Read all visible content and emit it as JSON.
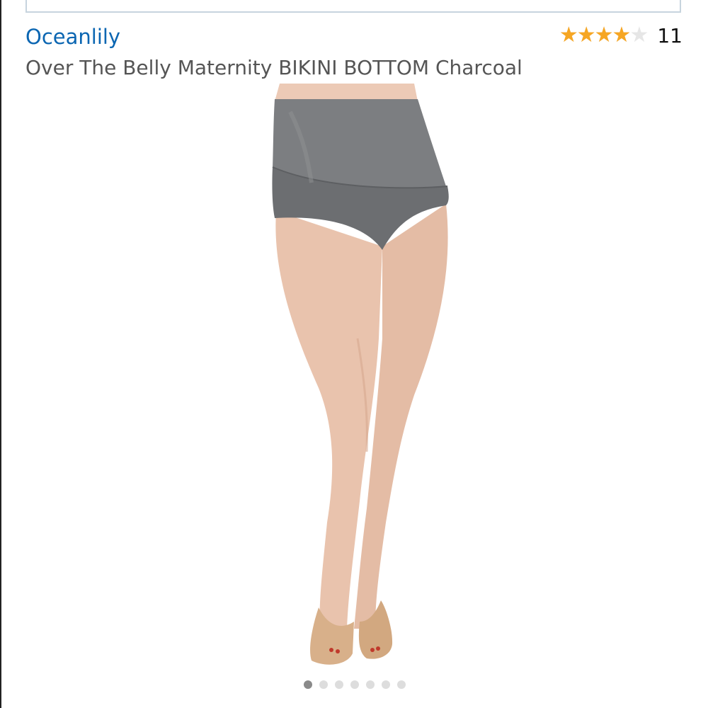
{
  "product": {
    "brand": "Oceanlily",
    "title": "Over The Belly Maternity BIKINI BOTTOM Charcoal",
    "rating": 4,
    "rating_max": 5,
    "review_count": "11",
    "stars_glyphs": "★★★★★"
  },
  "image": {
    "icon": "product-photo",
    "swimwear_color": "#727477",
    "skin_color": "#e9c3ad",
    "shoe_color": "#d8b08a"
  },
  "carousel": {
    "total": 7,
    "active_index": 0
  },
  "colors": {
    "brand_link": "#0b66b2",
    "star_filled": "#f6a623",
    "star_empty": "#e6e6e6"
  }
}
